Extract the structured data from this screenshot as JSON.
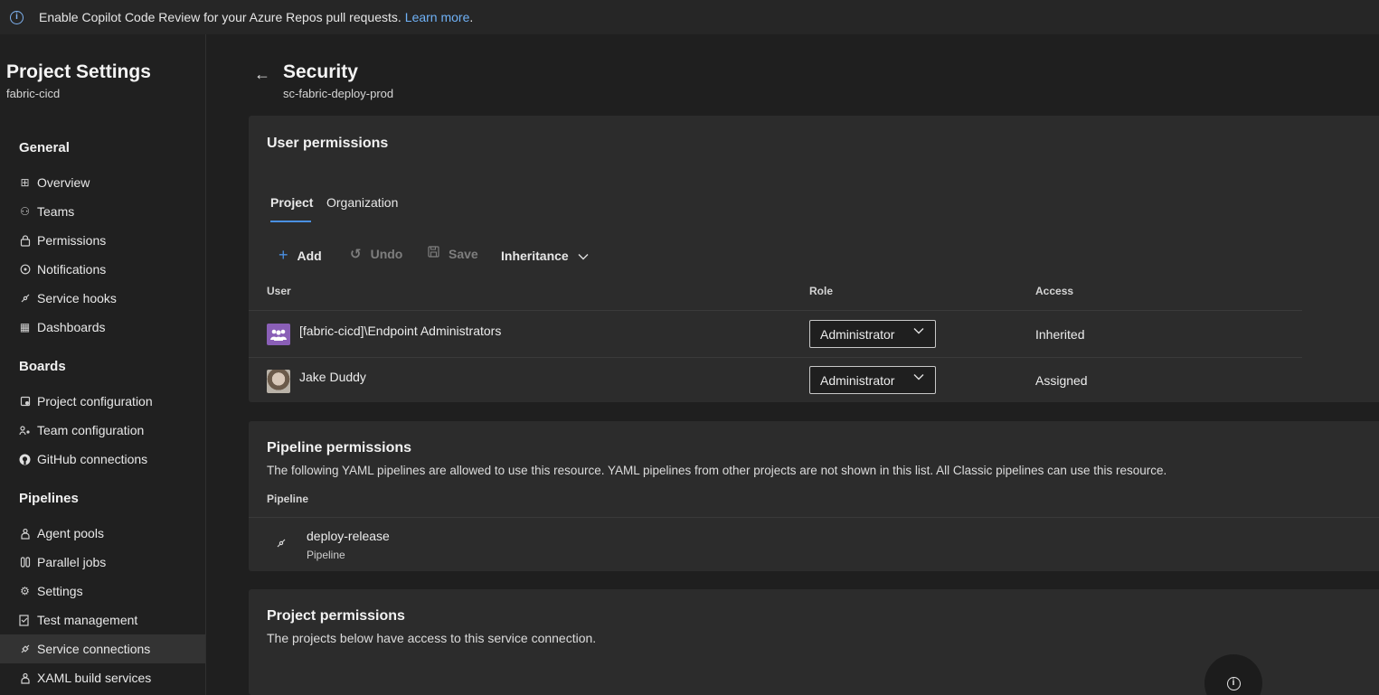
{
  "banner": {
    "icon": "info-icon",
    "text": "Enable Copilot Code Review for your Azure Repos pull requests.",
    "link": "Learn more",
    "suffix": "."
  },
  "sidebar": {
    "title": "Project Settings",
    "project": "fabric-cicd",
    "sections": {
      "general": "General",
      "boards": "Boards",
      "pipelines": "Pipelines"
    },
    "items": [
      {
        "label": "Overview",
        "icon": "overview-icon"
      },
      {
        "label": "Teams",
        "icon": "teams-icon"
      },
      {
        "label": "Permissions",
        "icon": "permissions-icon"
      },
      {
        "label": "Notifications",
        "icon": "notifications-icon"
      },
      {
        "label": "Service hooks",
        "icon": "service-hooks-icon"
      },
      {
        "label": "Dashboards",
        "icon": "dashboards-icon"
      },
      {
        "label": "Project configuration",
        "icon": "project-configuration-icon"
      },
      {
        "label": "Team configuration",
        "icon": "team-configuration-icon"
      },
      {
        "label": "GitHub connections",
        "icon": "github-icon"
      },
      {
        "label": "Agent pools",
        "icon": "agent-pools-icon"
      },
      {
        "label": "Parallel jobs",
        "icon": "parallel-jobs-icon"
      },
      {
        "label": "Settings",
        "icon": "settings-icon"
      },
      {
        "label": "Test management",
        "icon": "test-management-icon"
      },
      {
        "label": "Service connections",
        "icon": "service-connections-icon",
        "selected": true
      },
      {
        "label": "XAML build services",
        "icon": "xaml-build-icon"
      }
    ]
  },
  "header": {
    "title": "Security",
    "subtitle": "sc-fabric-deploy-prod"
  },
  "user_permissions": {
    "title": "User permissions",
    "tabs": [
      "Project",
      "Organization"
    ],
    "active_tab": "Project",
    "toolbar": {
      "add": "Add",
      "undo": "Undo",
      "save": "Save",
      "inheritance": "Inheritance"
    },
    "columns": [
      "User",
      "Role",
      "Access"
    ],
    "rows": [
      {
        "user": "[fabric-cicd]\\Endpoint Administrators",
        "role": "Administrator",
        "access": "Inherited",
        "avatar": "group-avatar"
      },
      {
        "user": "Jake Duddy",
        "role": "Administrator",
        "access": "Assigned",
        "avatar": "user-photo-avatar"
      }
    ]
  },
  "pipeline_permissions": {
    "title": "Pipeline permissions",
    "description": "The following YAML pipelines are allowed to use this resource. YAML pipelines from other projects are not shown in this list. All Classic pipelines can use this resource.",
    "column": "Pipeline",
    "items": [
      {
        "name": "deploy-release",
        "type": "Pipeline",
        "icon": "pipeline-icon"
      }
    ]
  },
  "project_permissions": {
    "title": "Project permissions",
    "description": "The projects below have access to this service connection."
  },
  "colors": {
    "background": "#1f1f1f",
    "card": "#2c2c2c",
    "accent": "#4a90e2",
    "link": "#6fb1f6"
  }
}
